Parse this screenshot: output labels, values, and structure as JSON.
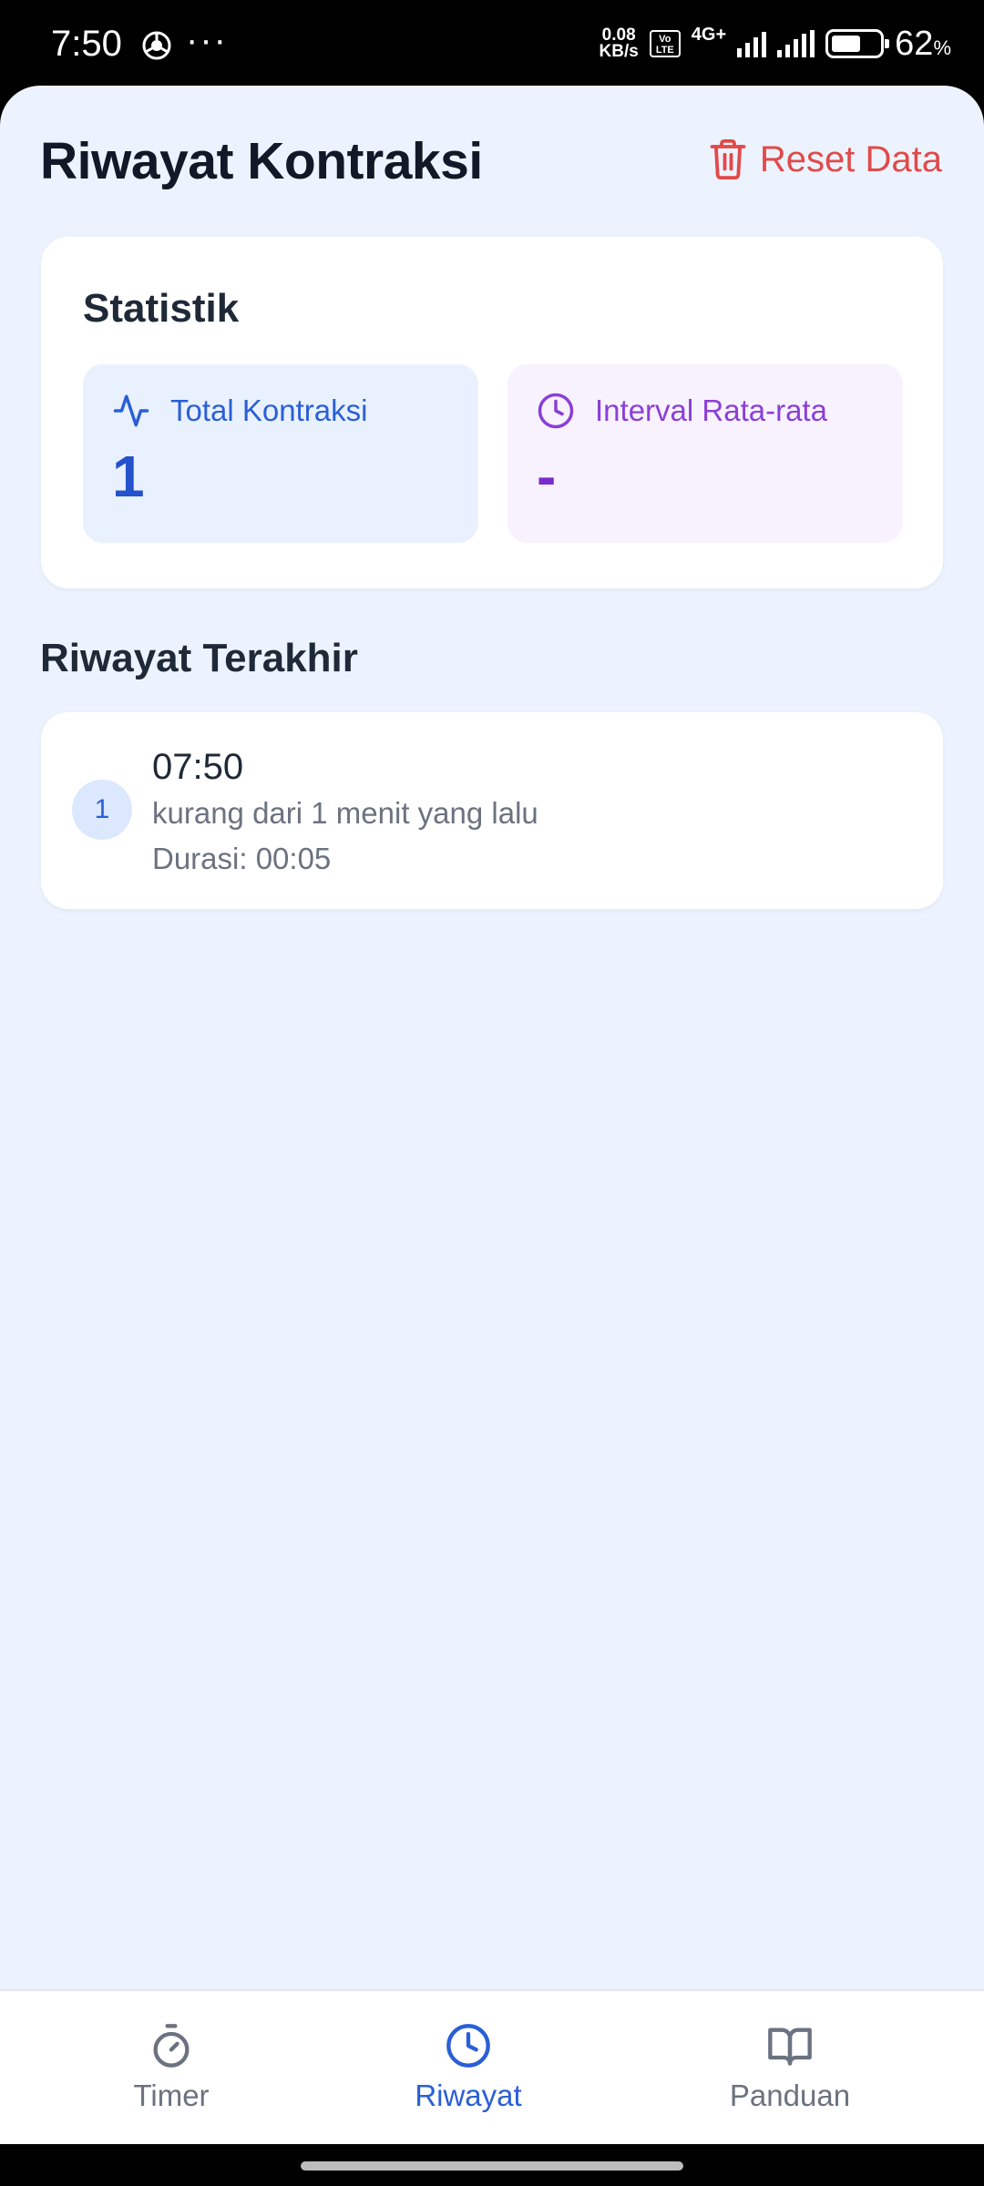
{
  "status_bar": {
    "time": "7:50",
    "dots": "···",
    "net_speed_value": "0.08",
    "net_speed_unit": "KB/s",
    "volte_top": "Vo",
    "volte_bottom": "LTE",
    "network": "4G+",
    "battery_percent": "62",
    "battery_unit": "%"
  },
  "header": {
    "title": "Riwayat Kontraksi",
    "reset_label": "Reset Data"
  },
  "stats": {
    "title": "Statistik",
    "total_label": "Total Kontraksi",
    "total_value": "1",
    "interval_label": "Interval Rata-rata",
    "interval_value": "-"
  },
  "recent": {
    "title": "Riwayat Terakhir",
    "items": [
      {
        "index": "1",
        "time": "07:50",
        "ago": "kurang dari 1 menit yang lalu",
        "duration": "Durasi: 00:05"
      }
    ]
  },
  "nav": {
    "items": [
      {
        "label": "Timer",
        "icon": "stopwatch-icon",
        "active": false
      },
      {
        "label": "Riwayat",
        "icon": "clock-icon",
        "active": true
      },
      {
        "label": "Panduan",
        "icon": "book-icon",
        "active": false
      }
    ]
  },
  "colors": {
    "background": "#edf3fe",
    "accent_blue": "#2a5fd6",
    "accent_purple": "#8b3fd6",
    "danger": "#e14a4a"
  }
}
